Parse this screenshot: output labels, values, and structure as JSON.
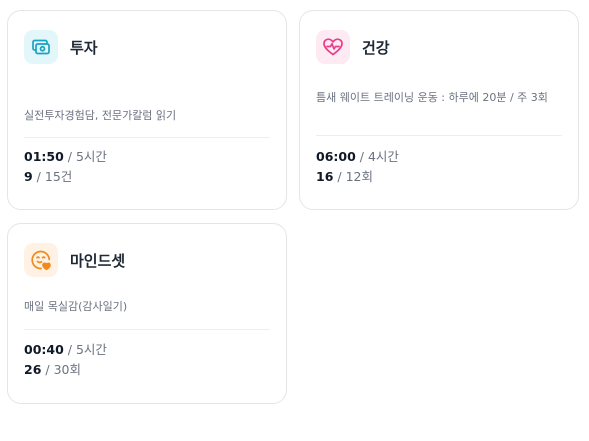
{
  "cards": [
    {
      "title": "투자",
      "icon": "money-wallet-icon",
      "icon_color": "#1aa3c2",
      "icon_bg": "#e3f6fa",
      "description": "실전투자경험담, 전문가칼럼 읽기",
      "time": {
        "current": "01:50",
        "separator": " / ",
        "total": "5시간"
      },
      "count": {
        "current": "9",
        "separator": " / ",
        "total": "15건"
      }
    },
    {
      "title": "건강",
      "icon": "heart-pulse-icon",
      "icon_color": "#e83e8c",
      "icon_bg": "#fdeaf3",
      "description": "틈새 웨이트 트레이닝 운동 : 하루에 20분 / 주 3회",
      "time": {
        "current": "06:00",
        "separator": " / ",
        "total": "4시간"
      },
      "count": {
        "current": "16",
        "separator": " / ",
        "total": "12회"
      }
    },
    {
      "title": "마인드셋",
      "icon": "smile-heart-icon",
      "icon_color": "#f08a1c",
      "icon_bg": "#fff1e3",
      "description": "매일 목실감(감사일기)",
      "time": {
        "current": "00:40",
        "separator": " / ",
        "total": "5시간"
      },
      "count": {
        "current": "26",
        "separator": " / ",
        "total": "30회"
      }
    }
  ]
}
